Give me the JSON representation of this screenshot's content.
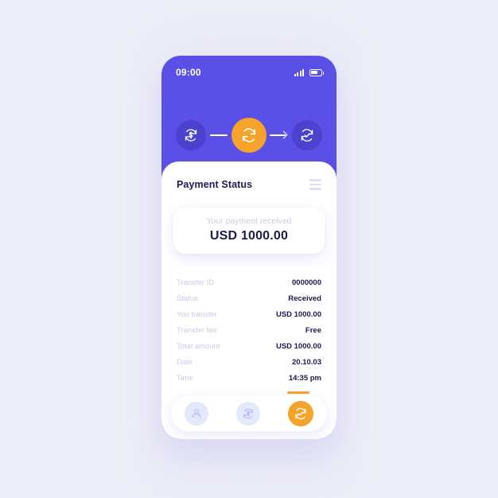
{
  "theme": {
    "page_bg": "#eeeef8",
    "header_purple": "#5a4fe6",
    "step_dim": "#4c41cf",
    "accent_orange": "#f5a32a",
    "text_navy": "#1b1b4d",
    "muted": "#c9cbe0",
    "nav_idle": "#e5e7fb"
  },
  "status_bar": {
    "time": "09:00",
    "signal_icon": "signal-bars-icon",
    "battery_icon": "battery-icon"
  },
  "progress_steps": [
    {
      "icon": "dollar-refresh-icon",
      "state": "done"
    },
    {
      "icon": "sync-refresh-icon",
      "state": "active"
    },
    {
      "icon": "check-refresh-icon",
      "state": "pending"
    }
  ],
  "connectors": [
    {
      "type": "line"
    },
    {
      "type": "arrow"
    }
  ],
  "sheet": {
    "title": "Payment Status",
    "menu_icon": "hamburger-menu-icon"
  },
  "amount_card": {
    "label": "Your payment received",
    "value": "USD 1000.00"
  },
  "details": [
    {
      "key": "Transfer ID",
      "value": "0000000"
    },
    {
      "key": "Status",
      "value": "Received"
    },
    {
      "key": "You transfer",
      "value": "USD 1000.00"
    },
    {
      "key": "Transfer fee",
      "value": "Free"
    },
    {
      "key": "Total amount",
      "value": "USD 1000.00"
    },
    {
      "key": "Date",
      "value": "20.10.03"
    },
    {
      "key": "Time",
      "value": "14:35 pm"
    }
  ],
  "expand": {
    "icon": "double-chevron-down-icon"
  },
  "bottom_nav": [
    {
      "icon": "person-icon",
      "active": false
    },
    {
      "icon": "dollar-refresh-icon",
      "active": false
    },
    {
      "icon": "check-refresh-icon",
      "active": true
    }
  ]
}
